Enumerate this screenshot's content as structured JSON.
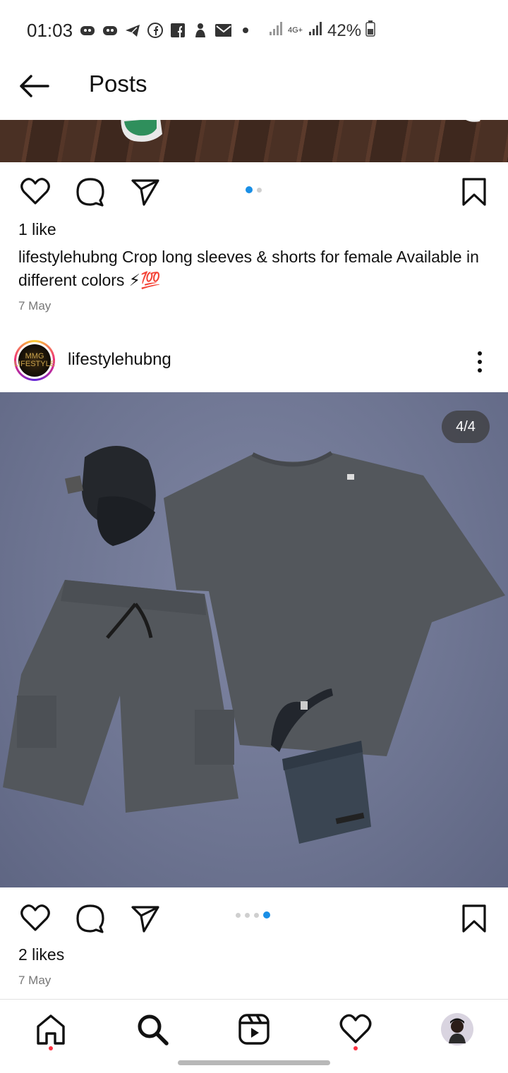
{
  "status_bar": {
    "time": "01:03",
    "network": "4G+",
    "battery": "42%",
    "icons": [
      "discord-icon",
      "discord-icon",
      "telegram-icon",
      "facebook-icon",
      "facebook-square-icon",
      "person-icon",
      "mail-icon",
      "dot-icon"
    ]
  },
  "header": {
    "title": "Posts",
    "back_icon": "arrow-left-icon"
  },
  "post1": {
    "likes": "1 like",
    "username": "lifestylehubng",
    "caption": "Crop long sleeves & shorts for female Available in different colors ⚡💯",
    "date": "7 May",
    "carousel": {
      "count": 2,
      "active": 0
    }
  },
  "post2": {
    "username": "lifestylehubng",
    "avatar_text": "MMG LIFESTYLE",
    "counter": "4/4",
    "likes": "2 likes",
    "date": "7 May",
    "carousel": {
      "count": 4,
      "active": 3
    }
  },
  "nav": {
    "items": [
      "home-icon",
      "search-icon",
      "reels-icon",
      "heart-icon",
      "profile-avatar"
    ]
  },
  "colors": {
    "accent_blue": "#1a8fe6",
    "notification_red": "#ff3040"
  }
}
